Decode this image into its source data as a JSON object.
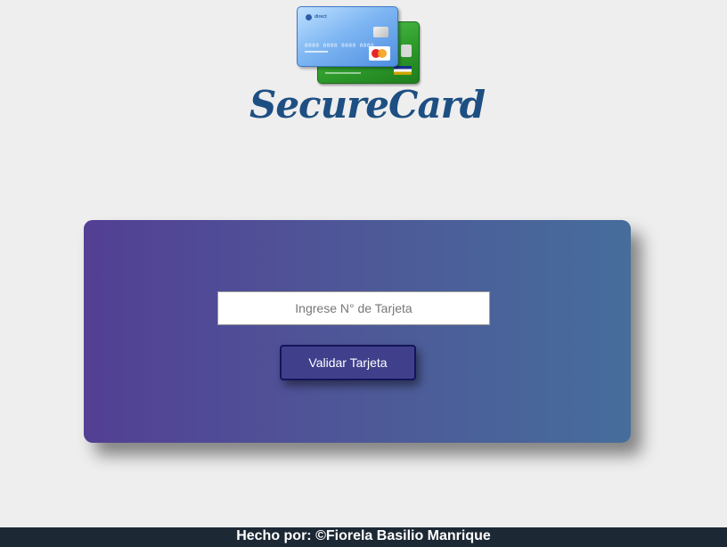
{
  "brand": {
    "title": "SecureCard",
    "logo_icon": "credit-cards-icon",
    "colors": {
      "title": "#1e4f82",
      "card_front": "#7fb7f3",
      "card_back": "#2f9e2c"
    }
  },
  "form": {
    "card_number_placeholder": "Ingrese N° de Tarjeta",
    "card_number_value": "",
    "validate_label": "Validar Tarjeta",
    "panel_gradient": [
      "#533f94",
      "#466d9c"
    ],
    "button_color": "#3f3f8c"
  },
  "footer": {
    "text": "Hecho por: ©Fiorela Basilio Manrique",
    "background": "#1c2834"
  }
}
